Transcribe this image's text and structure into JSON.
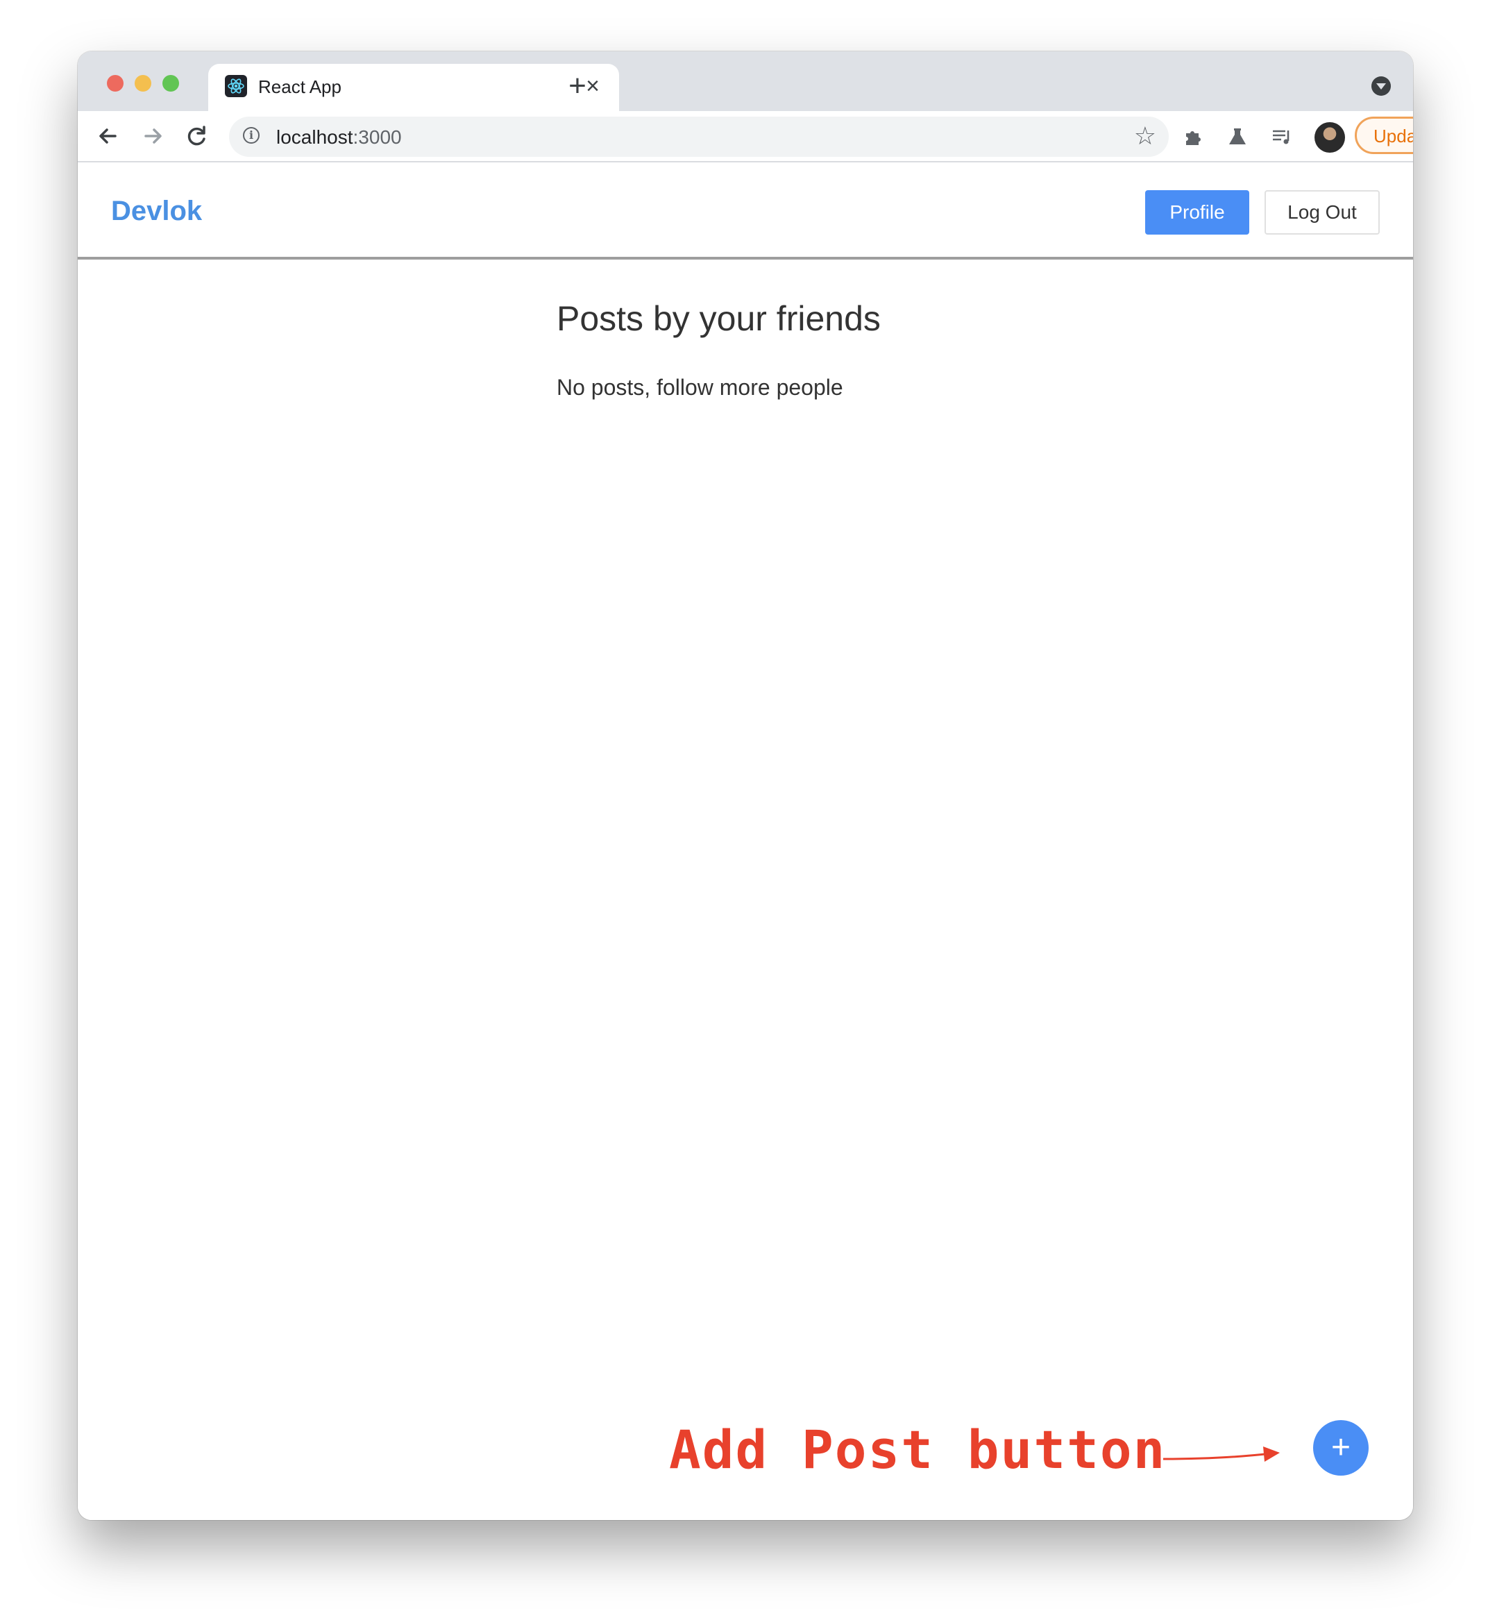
{
  "browser": {
    "tab_title": "React App",
    "tab_close": "×",
    "new_tab": "+",
    "url_host": "localhost",
    "url_port": ":3000",
    "update_label": "Update",
    "update_menu": "⋮"
  },
  "app": {
    "brand": "Devlok",
    "nav": {
      "profile_label": "Profile",
      "logout_label": "Log Out"
    },
    "feed": {
      "title": "Posts by your friends",
      "empty_message": "No posts, follow more people"
    },
    "fab_label": "+"
  },
  "annotation": {
    "text": "Add Post button"
  },
  "colors": {
    "brand": "#4a90e2",
    "primary_button": "#4a8ef5",
    "annotation": "#e8412c",
    "update_accent": "#e8710a"
  },
  "icons": {
    "back": "arrow-left-icon",
    "forward": "arrow-right-icon",
    "reload": "reload-icon",
    "info": "info-icon",
    "bookmark": "star-icon",
    "extensions": "puzzle-icon",
    "labs": "flask-icon",
    "media": "media-control-icon"
  }
}
